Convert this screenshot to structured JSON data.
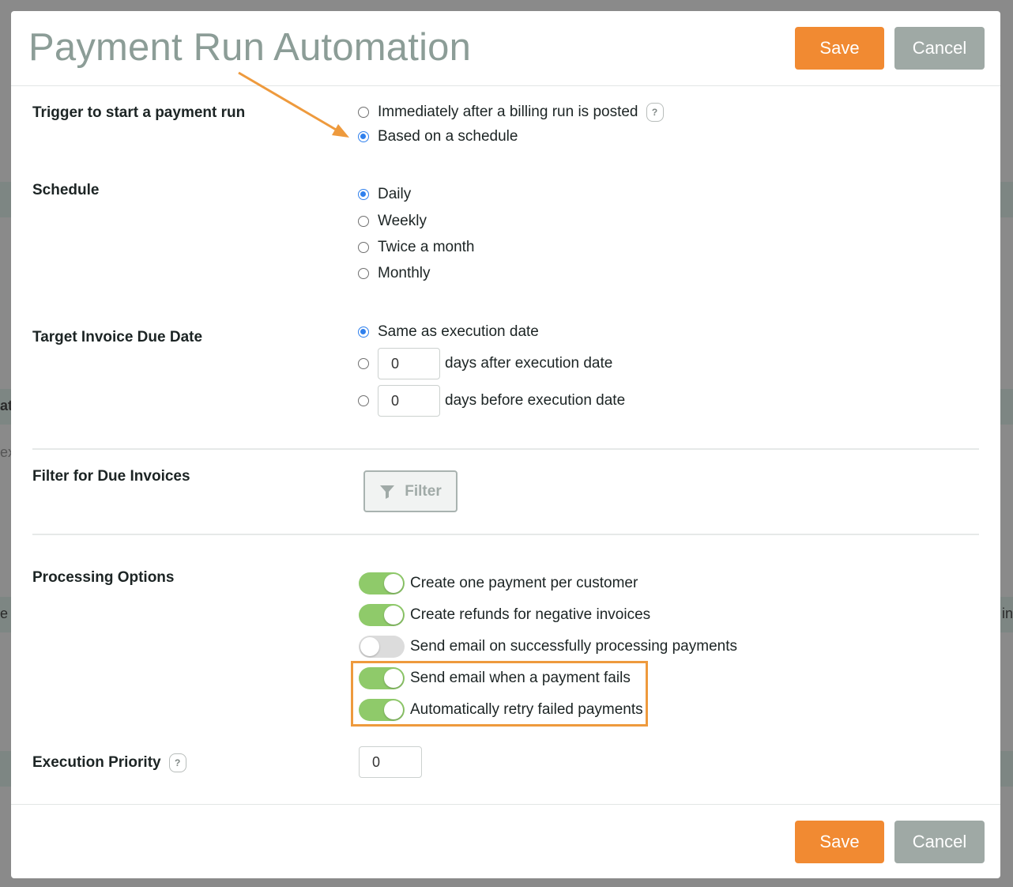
{
  "modal": {
    "title": "Payment Run Automation",
    "save_label": "Save",
    "cancel_label": "Cancel"
  },
  "background_fragments": [
    "at",
    "ex",
    "e",
    "in"
  ],
  "trigger": {
    "label": "Trigger to start a payment run",
    "options": [
      {
        "label": "Immediately after a billing run is posted",
        "selected": false,
        "help": "?"
      },
      {
        "label": "Based on a schedule",
        "selected": true
      }
    ]
  },
  "schedule": {
    "label": "Schedule",
    "options": [
      {
        "label": "Daily",
        "selected": true
      },
      {
        "label": "Weekly",
        "selected": false
      },
      {
        "label": "Twice a month",
        "selected": false
      },
      {
        "label": "Monthly",
        "selected": false
      }
    ]
  },
  "target_due_date": {
    "label": "Target Invoice Due Date",
    "options": [
      {
        "label": "Same as execution date",
        "selected": true
      },
      {
        "label": "days after execution date",
        "selected": false,
        "value": "0"
      },
      {
        "label": "days before execution date",
        "selected": false,
        "value": "0"
      }
    ]
  },
  "filter": {
    "label": "Filter for Due Invoices",
    "button_label": "Filter"
  },
  "processing": {
    "label": "Processing Options",
    "options": [
      {
        "label": "Create one payment per customer",
        "on": true
      },
      {
        "label": "Create refunds for negative invoices",
        "on": true
      },
      {
        "label": "Send email on successfully processing payments",
        "on": false
      },
      {
        "label": "Send email when a payment fails",
        "on": true
      },
      {
        "label": "Automatically retry failed payments",
        "on": true
      }
    ]
  },
  "execution_priority": {
    "label": "Execution Priority",
    "help": "?",
    "value": "0"
  },
  "colors": {
    "accent_orange": "#f18a32",
    "cancel_gray": "#9fa9a5",
    "toggle_on": "#8fca6a",
    "radio_selected": "#2f80ed",
    "title_gray": "#8c9d97"
  }
}
